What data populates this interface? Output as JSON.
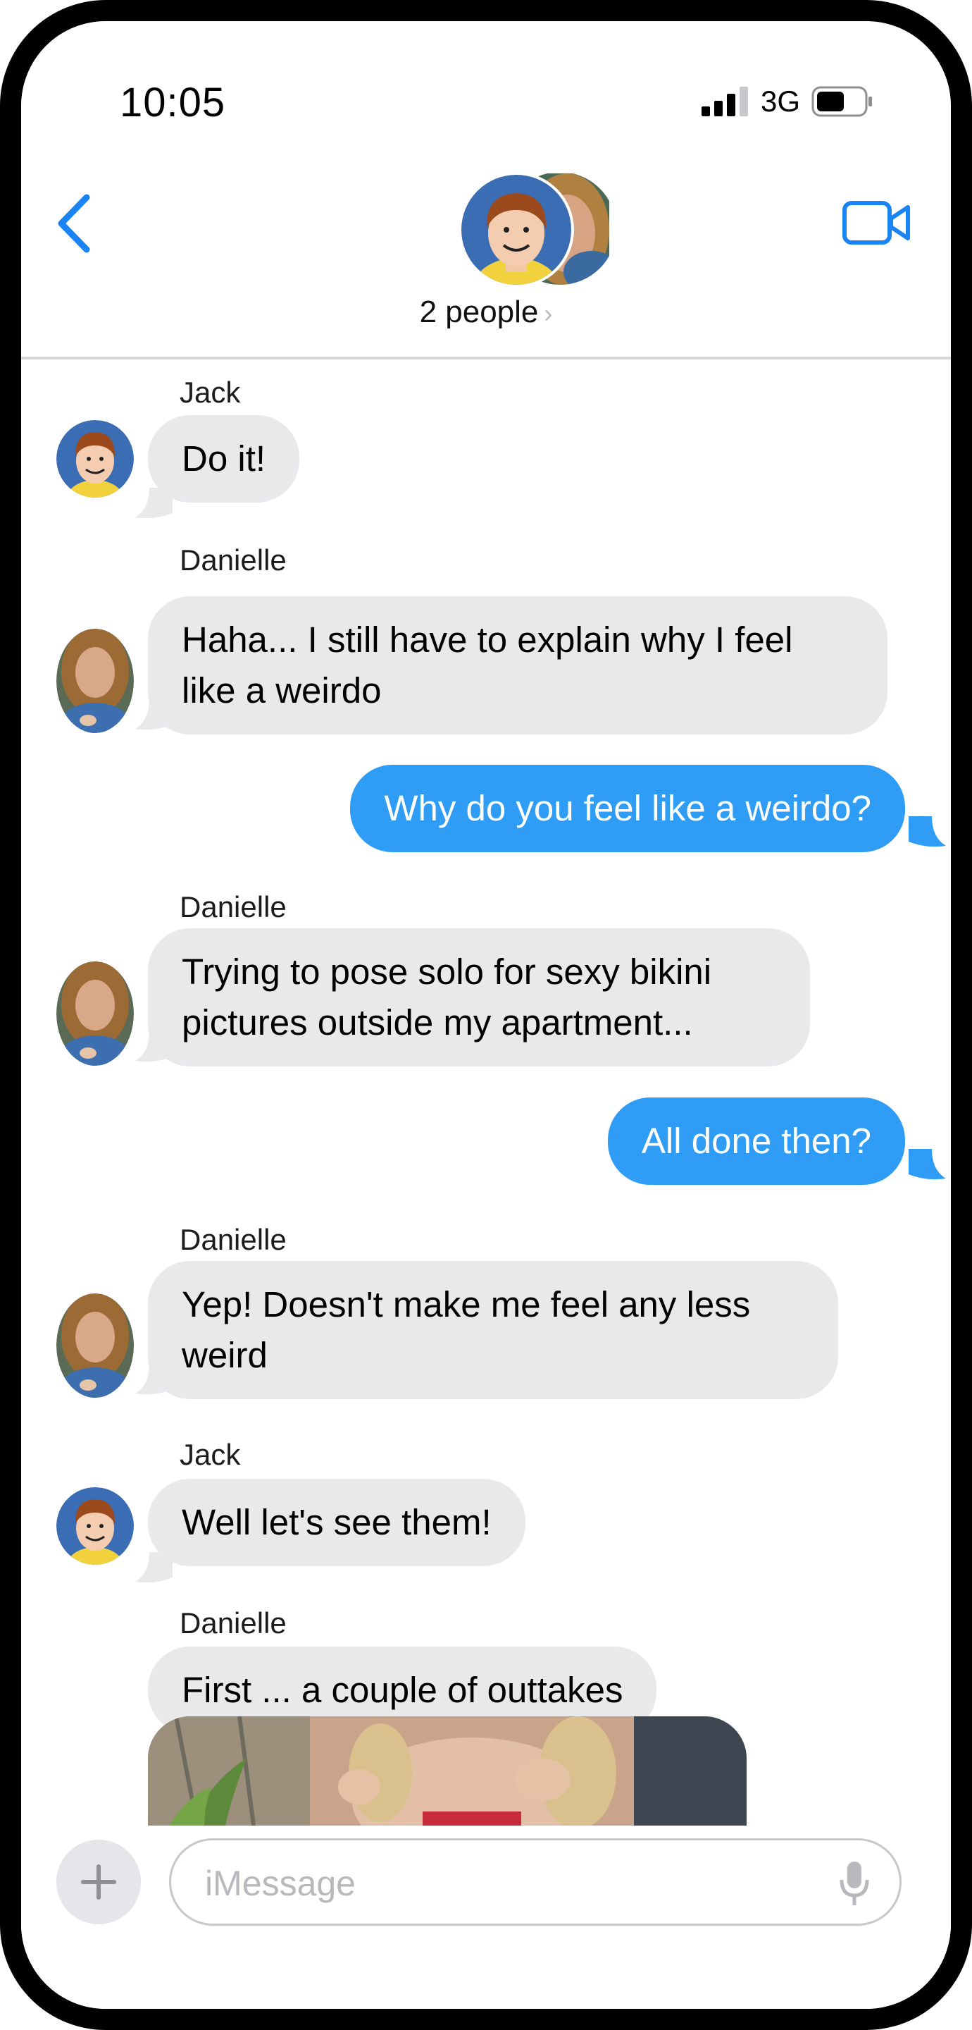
{
  "status_bar": {
    "time": "10:05",
    "network": "3G"
  },
  "header": {
    "title": "2 people",
    "chevron": "›"
  },
  "messages": [
    {
      "sender": "Jack",
      "text": "Do it!"
    },
    {
      "sender": "Danielle",
      "text": "Haha... I still have to explain why I feel like a weirdo"
    },
    {
      "text": "Why do you feel like a weirdo?"
    },
    {
      "sender": "Danielle",
      "text": "Trying to pose solo for sexy bikini pictures outside my apartment..."
    },
    {
      "text": "All done then?"
    },
    {
      "sender": "Danielle",
      "text": "Yep!  Doesn't make me feel any less weird"
    },
    {
      "sender": "Jack",
      "text": "Well let's see them!"
    },
    {
      "sender": "Danielle",
      "text": "First ... a couple of outtakes"
    }
  ],
  "compose": {
    "placeholder": "iMessage"
  },
  "colors": {
    "accent": "#2f9df5",
    "incoming_bubble": "#e9e9eb",
    "ios_blue": "#1a84f4"
  },
  "icons": [
    "back-chevron-icon",
    "video-call-icon",
    "plus-icon",
    "microphone-icon",
    "signal-icon",
    "battery-icon"
  ]
}
